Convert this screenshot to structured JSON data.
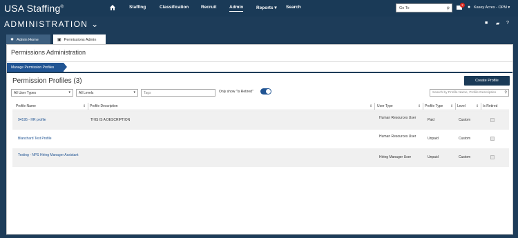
{
  "brand": "USA Staffing",
  "brand_mark": "®",
  "nav": {
    "items": [
      "Staffing",
      "Classification",
      "Recruit",
      "Admin",
      "Reports",
      "Search"
    ],
    "reports_caret": "▾",
    "goto_placeholder": "Go To",
    "notification_count": "2",
    "user_name": "Kasey Acres - OPM",
    "user_caret": "▾"
  },
  "header": {
    "title": "ADMINISTRATION",
    "title_caret": "⌄"
  },
  "tabs": [
    {
      "label": "Admin Home",
      "icon": "gear-icon"
    },
    {
      "label": "Permissions Admin",
      "icon": "briefcase-icon"
    }
  ],
  "page_title": "Permissions Administration",
  "breadcrumb": "Manage Permission Profiles",
  "section": {
    "title": "Permission Profiles (3)",
    "create_button": "Create Profile"
  },
  "filters": {
    "user_types": "All User Types",
    "levels": "All Levels",
    "tags_placeholder": "Tags",
    "retired_label": "Only show \"Is Retired\"",
    "retired_on": true,
    "search_placeholder": "Search by Profile Name, Profile Description"
  },
  "table": {
    "columns": [
      "Profile Name",
      "Profile Description",
      "User Type",
      "Profile Type",
      "Level",
      "Is Retired"
    ],
    "rows": [
      {
        "name": "94195 - HR profile",
        "description": "THIS IS A DESCRIPTION",
        "user_type": "Human Resources User",
        "profile_type": "Paid",
        "level": "Custom",
        "is_retired": false
      },
      {
        "name": "Blanchard Test Profile",
        "description": "",
        "user_type": "Human Resources User",
        "profile_type": "Unpaid",
        "level": "Custom",
        "is_retired": false
      },
      {
        "name": "Testing - NPS Hiring Manager Assistant",
        "description": "",
        "user_type": "Hiring Manager User",
        "profile_type": "Unpaid",
        "level": "Custom",
        "is_retired": false
      }
    ]
  },
  "colors": {
    "nav_bg": "#1a3a57",
    "accent": "#205493",
    "badge": "#d9261c"
  }
}
